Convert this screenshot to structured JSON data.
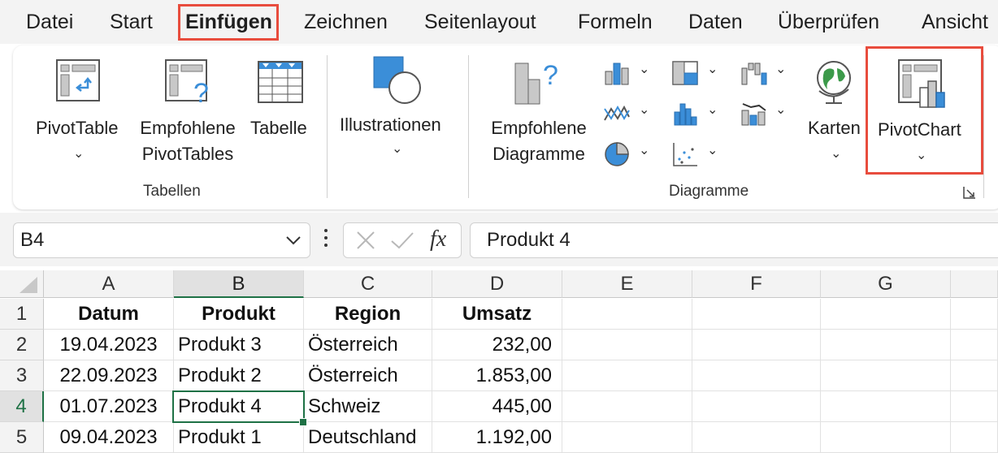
{
  "menu": {
    "items": [
      "Datei",
      "Start",
      "Einfügen",
      "Zeichnen",
      "Seitenlayout",
      "Formeln",
      "Daten",
      "Überprüfen",
      "Ansicht"
    ],
    "active_index": 2
  },
  "ribbon": {
    "tables": {
      "group_label": "Tabellen",
      "pivottable": "PivotTable",
      "recommended_line1": "Empfohlene",
      "recommended_line2": "PivotTables",
      "table": "Tabelle"
    },
    "illustrations": {
      "label": "Illustrationen"
    },
    "charts": {
      "group_label": "Diagramme",
      "recommended_line1": "Empfohlene",
      "recommended_line2": "Diagramme",
      "maps": "Karten",
      "pivotchart": "PivotChart"
    }
  },
  "formula_bar": {
    "name_box": "B4",
    "fx": "fx",
    "value": "Produkt 4"
  },
  "sheet": {
    "columns": [
      "A",
      "B",
      "C",
      "D",
      "E",
      "F",
      "G"
    ],
    "row_numbers": [
      "1",
      "2",
      "3",
      "4",
      "5"
    ],
    "rows": [
      [
        "Datum",
        "Produkt",
        "Region",
        "Umsatz"
      ],
      [
        "19.04.2023",
        "Produkt 3",
        "Österreich",
        "232,00"
      ],
      [
        "22.09.2023",
        "Produkt 2",
        "Österreich",
        "1.853,00"
      ],
      [
        "01.07.2023",
        "Produkt 4",
        "Schweiz",
        "445,00"
      ],
      [
        "09.04.2023",
        "Produkt 1",
        "Deutschland",
        "1.192,00"
      ]
    ]
  },
  "colors": {
    "highlight": "#e84c3d",
    "selection": "#1e7145",
    "icon_blue": "#3b8ed8"
  }
}
